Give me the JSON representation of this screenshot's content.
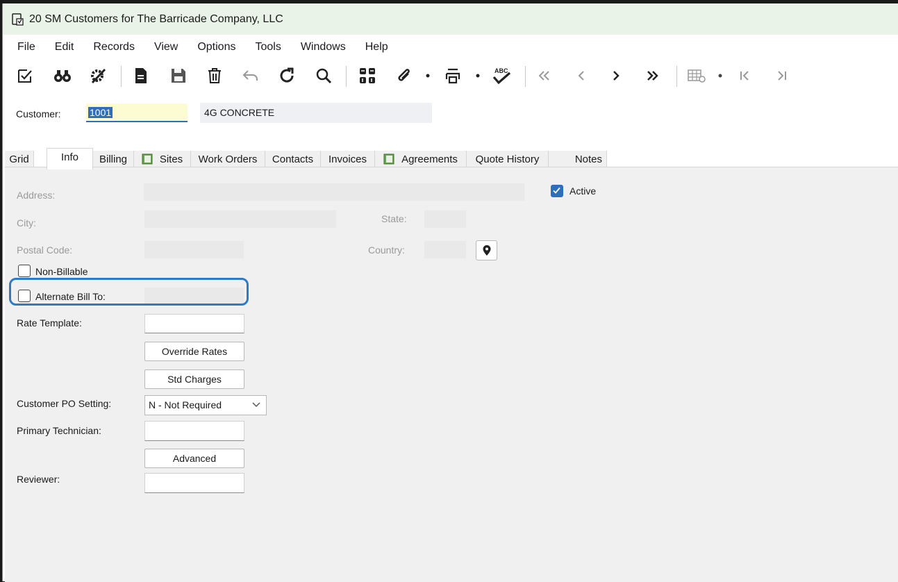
{
  "window": {
    "title": "20 SM Customers for The Barricade Company, LLC",
    "icon": "form-document-icon"
  },
  "menu": [
    "File",
    "Edit",
    "Records",
    "View",
    "Options",
    "Tools",
    "Windows",
    "Help"
  ],
  "toolbar": {
    "icons": [
      "edit-check-icon",
      "binoculars-icon",
      "tools-gear-icon",
      "new-document-icon",
      "save-icon",
      "delete-icon",
      "undo-icon",
      "refresh-icon",
      "search-icon",
      "grid-layout-icon",
      "attachment-icon",
      "print-icon",
      "spellcheck-icon",
      "first-record-icon",
      "previous-record-icon",
      "next-record-icon",
      "last-record-icon",
      "grid-settings-icon",
      "first-page-icon",
      "last-page-icon"
    ]
  },
  "header": {
    "customer_label": "Customer:",
    "customer_id": "1001",
    "customer_name": "4G CONCRETE"
  },
  "tabs": [
    "Grid",
    "Info",
    "Billing",
    "Sites",
    "Work Orders",
    "Contacts",
    "Invoices",
    "Agreements",
    "Quote History",
    "Notes"
  ],
  "active_tab": "Info",
  "info": {
    "address_label": "Address:",
    "city_label": "City:",
    "state_label": "State:",
    "postal_label": "Postal Code:",
    "country_label": "Country:",
    "active_label": "Active",
    "active_checked": true,
    "non_billable_label": "Non-Billable",
    "non_billable_checked": false,
    "alt_bill_label": "Alternate Bill To:",
    "alt_bill_checked": false,
    "rate_template_label": "Rate Template:",
    "override_rates_button": "Override Rates",
    "std_charges_button": "Std Charges",
    "po_setting_label": "Customer PO Setting:",
    "po_setting_value": "N - Not Required",
    "primary_tech_label": "Primary Technician:",
    "advanced_button": "Advanced",
    "reviewer_label": "Reviewer:"
  },
  "colors": {
    "accent": "#2d6fb8",
    "highlight": "#2d7bc4",
    "title_bar": "#eaf3e8",
    "panel": "#f0f0f0"
  }
}
